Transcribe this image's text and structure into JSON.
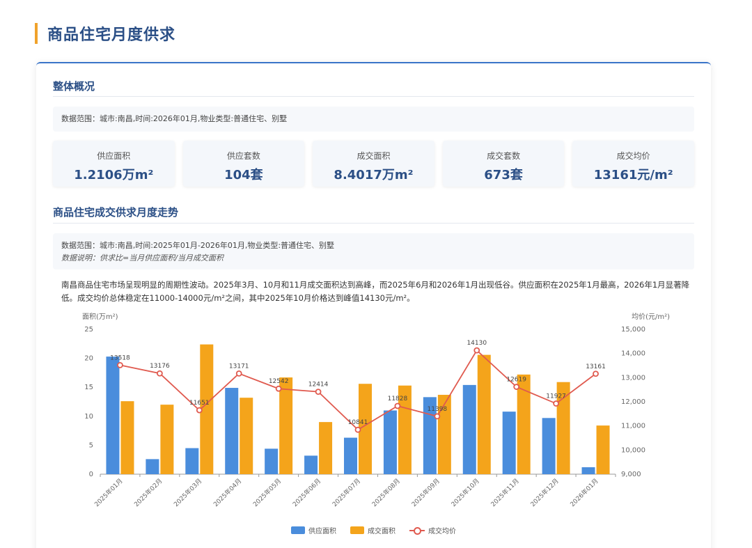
{
  "page": {
    "title": "商品住宅月度供求"
  },
  "overview": {
    "title": "整体概况",
    "scope": "数据范围：城市:南昌,时间:2026年01月,物业类型:普通住宅、别墅",
    "stats": [
      {
        "label": "供应面积",
        "value": "1.2106万m²"
      },
      {
        "label": "供应套数",
        "value": "104套"
      },
      {
        "label": "成交面积",
        "value": "8.4017万m²"
      },
      {
        "label": "成交套数",
        "value": "673套"
      },
      {
        "label": "成交均价",
        "value": "13161元/m²"
      }
    ]
  },
  "trend": {
    "title": "商品住宅成交供求月度走势",
    "scope": "数据范围：城市:南昌,时间:2025年01月-2026年01月,物业类型:普通住宅、别墅",
    "note": "数据说明：供求比=当月供应面积/当月成交面积",
    "description": "南昌商品住宅市场呈现明显的周期性波动。2025年3月、10月和11月成交面积达到高峰，而2025年6月和2026年1月出现低谷。供应面积在2025年1月最高，2026年1月显著降低。成交均价总体稳定在11000-14000元/m²之间，其中2025年10月价格达到峰值14130元/m²。"
  },
  "chart_data": {
    "type": "bar",
    "categories": [
      "2025年01月",
      "2025年02月",
      "2025年03月",
      "2025年04月",
      "2025年05月",
      "2025年06月",
      "2025年07月",
      "2025年08月",
      "2025年09月",
      "2025年10月",
      "2025年11月",
      "2025年12月",
      "2026年01月"
    ],
    "ylabel": "面积(万m²)",
    "ylabel_right": "均价(元/m²)",
    "ylim": [
      0,
      25
    ],
    "yticks": [
      0,
      5,
      10,
      15,
      20,
      25
    ],
    "ylim_right": [
      9000,
      15000
    ],
    "yticks_right": [
      "9,000",
      "10,000",
      "11,000",
      "12,000",
      "13,000",
      "14,000",
      "15,000"
    ],
    "series": [
      {
        "name": "供应面积",
        "type": "bar",
        "color": "#4a8ddc",
        "values": [
          20.3,
          2.6,
          4.5,
          14.9,
          4.4,
          3.2,
          6.3,
          11.0,
          13.3,
          15.4,
          10.8,
          9.7,
          1.2
        ]
      },
      {
        "name": "成交面积",
        "type": "bar",
        "color": "#f4a41b",
        "values": [
          12.6,
          12.0,
          22.4,
          13.2,
          16.7,
          9.0,
          15.6,
          15.3,
          13.7,
          20.6,
          17.2,
          15.9,
          8.4
        ]
      },
      {
        "name": "成交均价",
        "type": "line",
        "axis": "right",
        "color": "#e05a4f",
        "values": [
          13518,
          13176,
          11651,
          13171,
          12542,
          12414,
          10841,
          11828,
          11398,
          14130,
          12619,
          11927,
          13161
        ]
      }
    ],
    "grid": false,
    "legend": "bottom-center"
  }
}
